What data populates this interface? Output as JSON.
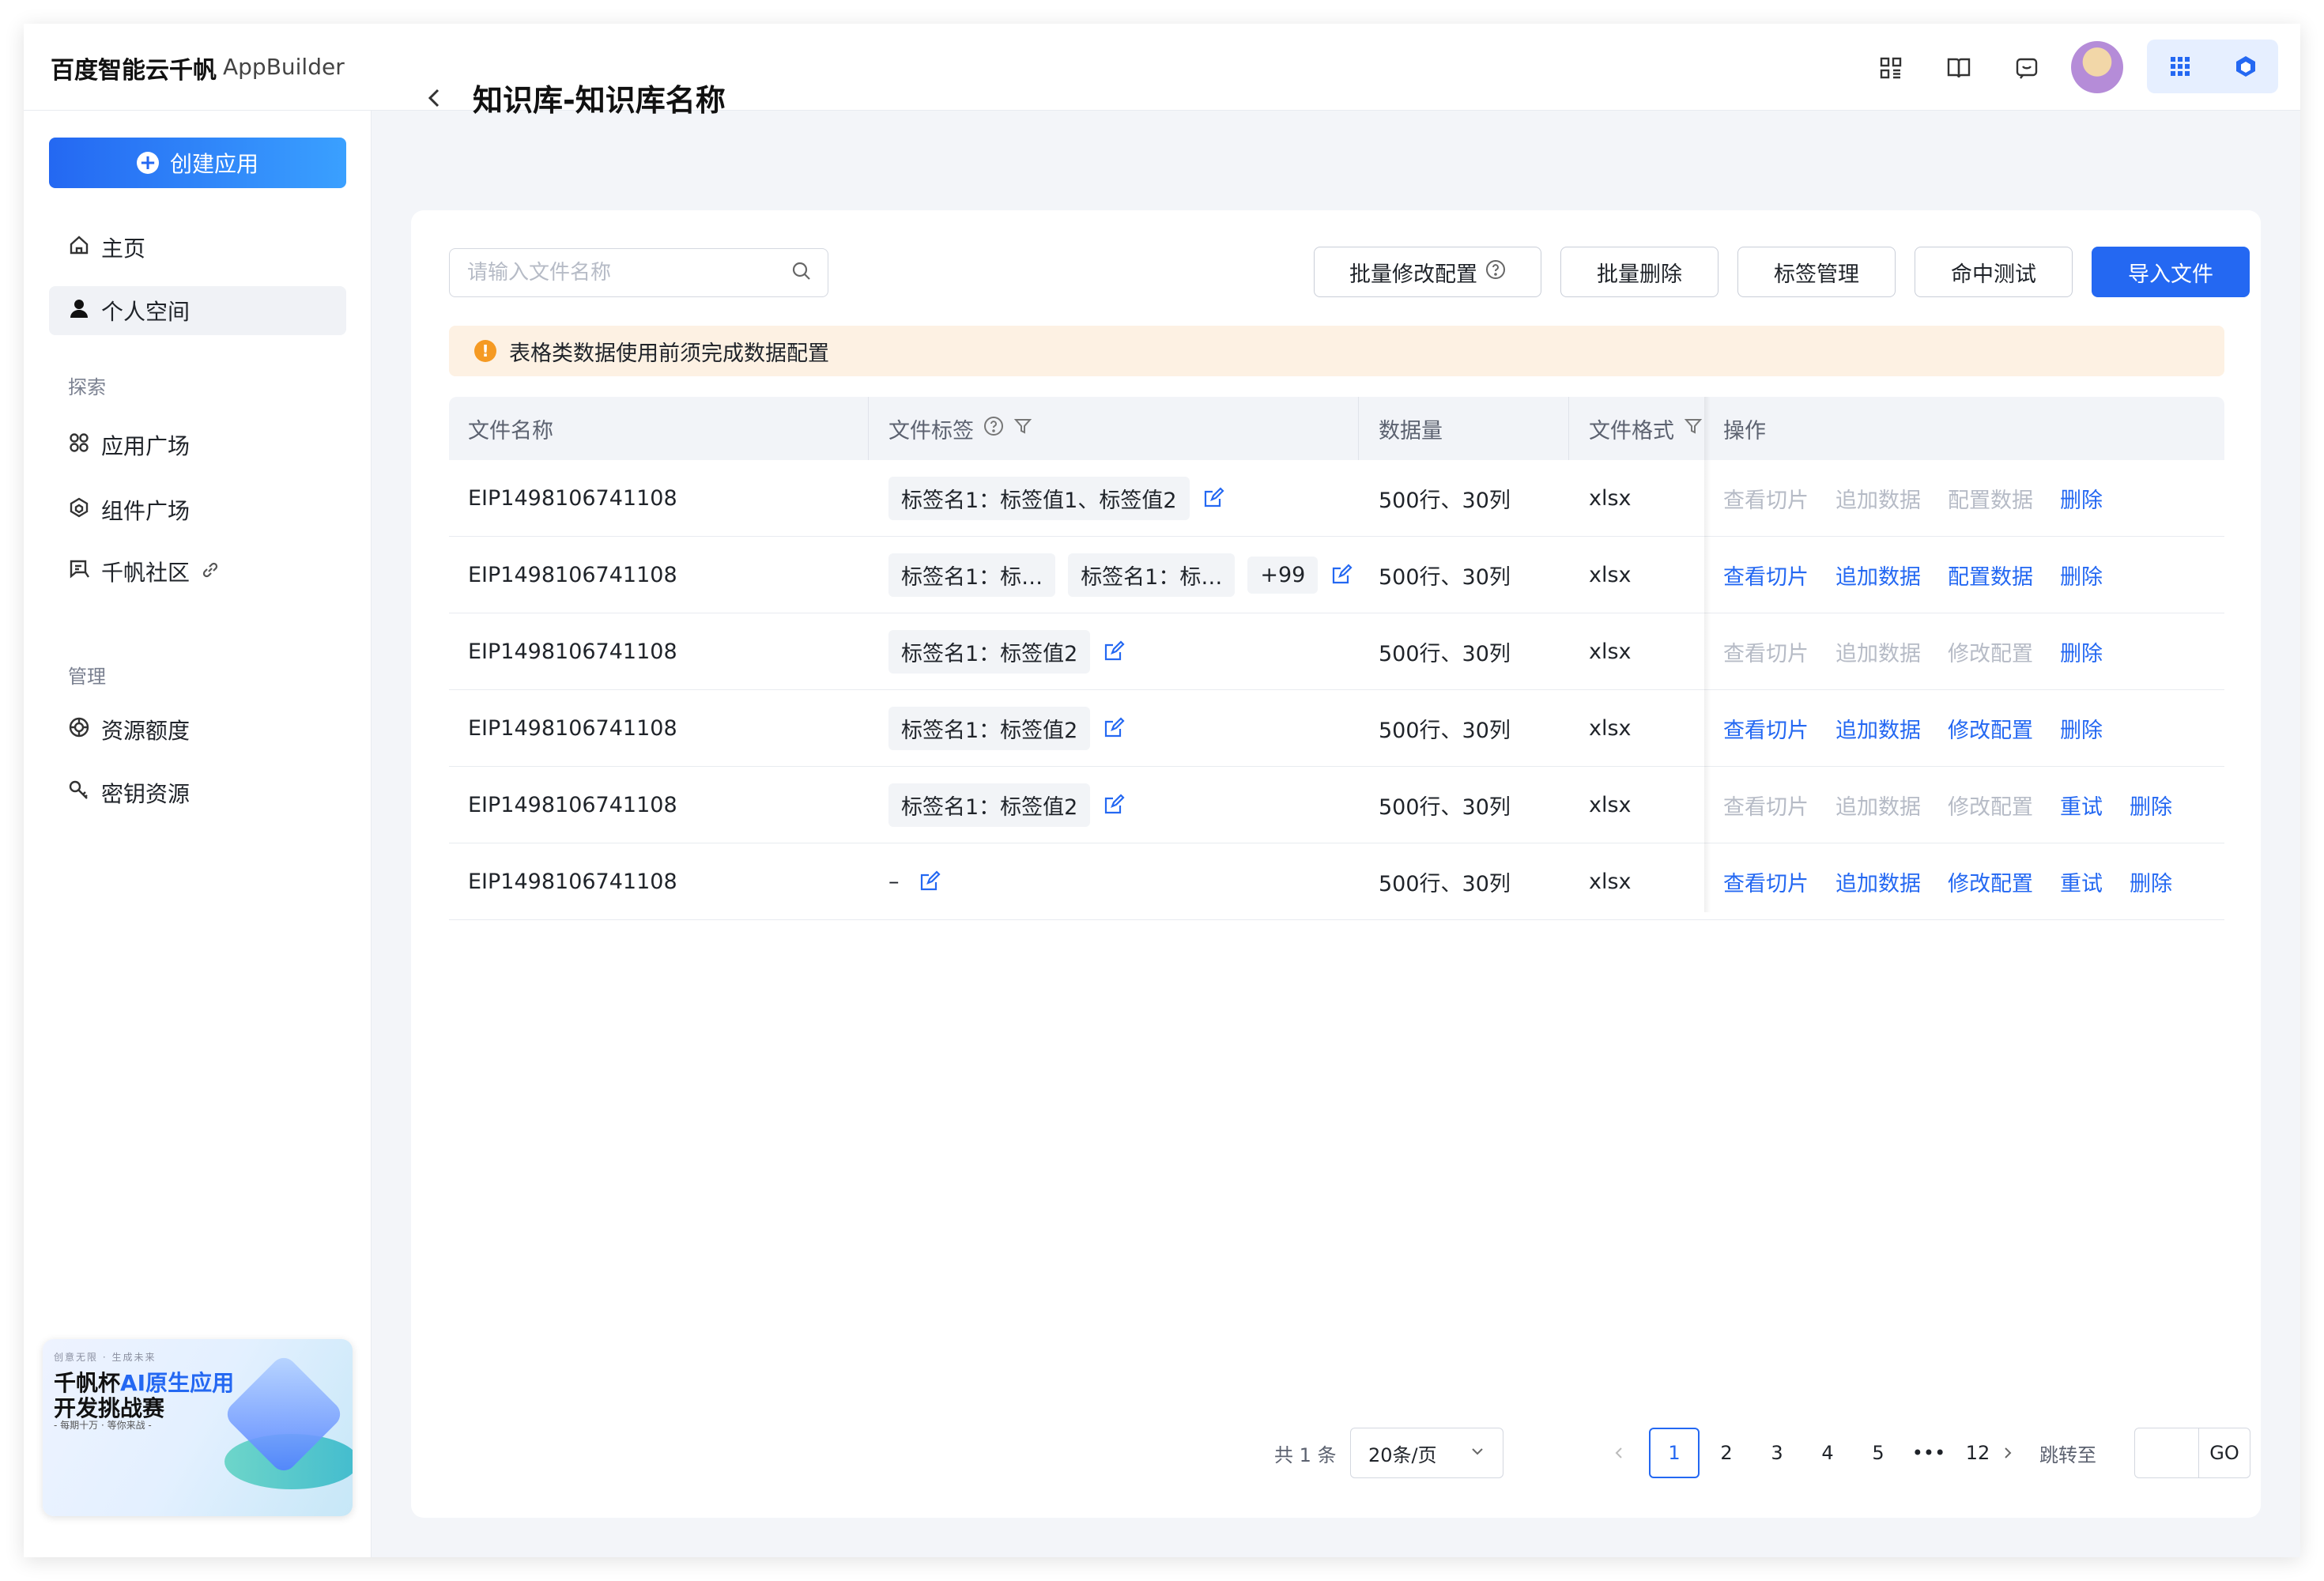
{
  "brand": {
    "name": "百度智能云千帆",
    "product": "AppBuilder"
  },
  "header": {
    "icons": [
      "grid-icon",
      "book-icon",
      "feedback-icon"
    ],
    "app_switch_icons": [
      "apps-grid-icon",
      "cube-logo-icon"
    ]
  },
  "sidebar": {
    "create_label": "创建应用",
    "items": [
      {
        "label": "主页",
        "icon": "home-icon"
      },
      {
        "label": "个人空间",
        "icon": "user-icon"
      }
    ],
    "explore_title": "探索",
    "explore_items": [
      {
        "label": "应用广场",
        "icon": "apps-icon"
      },
      {
        "label": "组件广场",
        "icon": "component-icon"
      },
      {
        "label": "千帆社区",
        "icon": "community-icon"
      }
    ],
    "manage_title": "管理",
    "manage_items": [
      {
        "label": "资源额度",
        "icon": "quota-icon"
      },
      {
        "label": "密钥资源",
        "icon": "key-icon"
      }
    ],
    "banner": {
      "small": "创意无限 · 生成未来",
      "line1_a": "千帆杯",
      "line1_b": "AI原生应用",
      "line2": "开发挑战赛",
      "line3": "- 每期十万 · 等你来战 -"
    }
  },
  "page": {
    "title": "知识库-知识库名称"
  },
  "toolbar": {
    "search_placeholder": "请输入文件名称",
    "batch_config": "批量修改配置",
    "batch_delete": "批量删除",
    "tag_manage": "标签管理",
    "hit_test": "命中测试",
    "import": "导入文件"
  },
  "alert": {
    "text": "表格类数据使用前须完成数据配置"
  },
  "table": {
    "columns": [
      "文件名称",
      "文件标签",
      "数据量",
      "文件格式",
      "操作"
    ],
    "rows": [
      {
        "name": "EIP1498106741108",
        "tags": [
          "标签名1：标签值1、标签值2"
        ],
        "size": "500行、30列",
        "format": "xlsx",
        "ops": [
          [
            "查看切片",
            false
          ],
          [
            "追加数据",
            false
          ],
          [
            "配置数据",
            false
          ],
          [
            "删除",
            true
          ]
        ]
      },
      {
        "name": "EIP1498106741108",
        "tags": [
          "标签名1：标…",
          "标签名1：标…",
          "+99"
        ],
        "size": "500行、30列",
        "format": "xlsx",
        "ops": [
          [
            "查看切片",
            true
          ],
          [
            "追加数据",
            true
          ],
          [
            "配置数据",
            true
          ],
          [
            "删除",
            true
          ]
        ]
      },
      {
        "name": "EIP1498106741108",
        "tags": [
          "标签名1：标签值2"
        ],
        "size": "500行、30列",
        "format": "xlsx",
        "ops": [
          [
            "查看切片",
            false
          ],
          [
            "追加数据",
            false
          ],
          [
            "修改配置",
            false
          ],
          [
            "删除",
            true
          ]
        ]
      },
      {
        "name": "EIP1498106741108",
        "tags": [
          "标签名1：标签值2"
        ],
        "size": "500行、30列",
        "format": "xlsx",
        "ops": [
          [
            "查看切片",
            true
          ],
          [
            "追加数据",
            true
          ],
          [
            "修改配置",
            true
          ],
          [
            "删除",
            true
          ]
        ]
      },
      {
        "name": "EIP1498106741108",
        "tags": [
          "标签名1：标签值2"
        ],
        "size": "500行、30列",
        "format": "xlsx",
        "ops": [
          [
            "查看切片",
            false
          ],
          [
            "追加数据",
            false
          ],
          [
            "修改配置",
            false
          ],
          [
            "重试",
            true
          ],
          [
            "删除",
            true
          ]
        ]
      },
      {
        "name": "EIP1498106741108",
        "tags": [],
        "empty_tag": "–",
        "size": "500行、30列",
        "format": "xlsx",
        "ops": [
          [
            "查看切片",
            true
          ],
          [
            "追加数据",
            true
          ],
          [
            "修改配置",
            true
          ],
          [
            "重试",
            true
          ],
          [
            "删除",
            true
          ]
        ]
      }
    ]
  },
  "pagination": {
    "total": "共 1 条",
    "page_size": "20条/页",
    "pages": [
      "1",
      "2",
      "3",
      "4",
      "5",
      "•••",
      "12"
    ],
    "current": "1",
    "jump_label": "跳转至",
    "go_label": "GO"
  },
  "colors": {
    "primary": "#2468f2",
    "disabled": "#b6bbc6",
    "warning": "#f59a23",
    "alert_bg": "#fdf1e3"
  }
}
